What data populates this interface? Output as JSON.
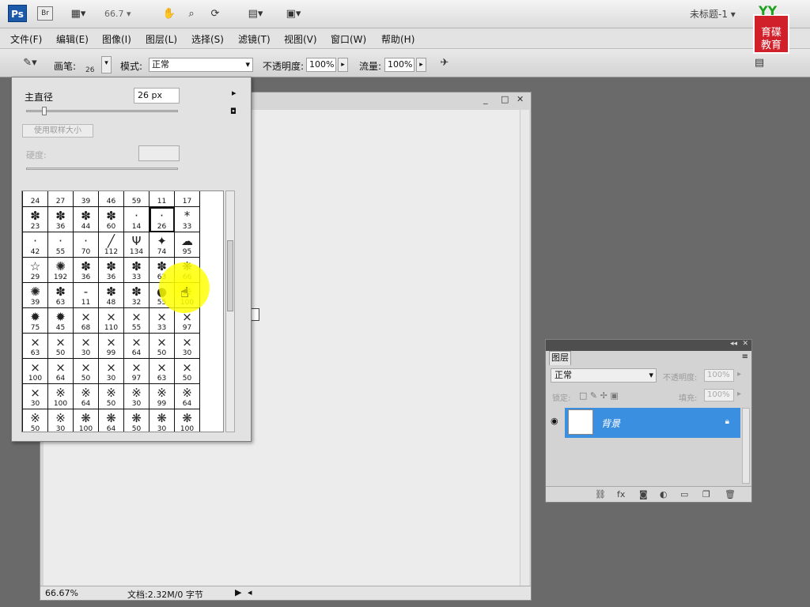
{
  "appbar": {
    "app_badge": "Ps",
    "bridge_badge": "Br",
    "zoom": "66.7",
    "document_title": "未标题-1",
    "watermark_line1": "育碟",
    "watermark_line2": "教育",
    "watermark_top": "YY"
  },
  "menu": [
    "文件(F)",
    "编辑(E)",
    "图像(I)",
    "图层(L)",
    "选择(S)",
    "滤镜(T)",
    "视图(V)",
    "窗口(W)",
    "帮助(H)"
  ],
  "options": {
    "brush_label": "画笔:",
    "brush_size": "26",
    "mode_label": "模式:",
    "mode_value": "正常",
    "opacity_label": "不透明度:",
    "opacity_value": "100%",
    "flow_label": "流量:",
    "flow_value": "100%"
  },
  "brush_picker": {
    "master_diameter_label": "主直径",
    "master_diameter_value": "26 px",
    "use_sample_size": "使用取样大小",
    "hardness_label": "硬度:",
    "brushes": [
      {
        "g": "",
        "s": "24"
      },
      {
        "g": "",
        "s": "27"
      },
      {
        "g": "",
        "s": "39"
      },
      {
        "g": "",
        "s": "46"
      },
      {
        "g": "",
        "s": "59"
      },
      {
        "g": "",
        "s": "11"
      },
      {
        "g": "",
        "s": "17"
      },
      {
        "g": "✽",
        "s": "23"
      },
      {
        "g": "✽",
        "s": "36"
      },
      {
        "g": "✽",
        "s": "44"
      },
      {
        "g": "✽",
        "s": "60"
      },
      {
        "g": "·",
        "s": "14"
      },
      {
        "g": "·",
        "s": "26"
      },
      {
        "g": "*",
        "s": "33"
      },
      {
        "g": "·",
        "s": "42"
      },
      {
        "g": "·",
        "s": "55"
      },
      {
        "g": "·",
        "s": "70"
      },
      {
        "g": "╱",
        "s": "112"
      },
      {
        "g": "Ψ",
        "s": "134"
      },
      {
        "g": "✦",
        "s": "74"
      },
      {
        "g": "☁",
        "s": "95"
      },
      {
        "g": "☆",
        "s": "29"
      },
      {
        "g": "✺",
        "s": "192"
      },
      {
        "g": "✽",
        "s": "36"
      },
      {
        "g": "✽",
        "s": "36"
      },
      {
        "g": "✽",
        "s": "33"
      },
      {
        "g": "✽",
        "s": "63"
      },
      {
        "g": "❋",
        "s": "66"
      },
      {
        "g": "✺",
        "s": "39"
      },
      {
        "g": "✽",
        "s": "63"
      },
      {
        "g": "-",
        "s": "11"
      },
      {
        "g": "✽",
        "s": "48"
      },
      {
        "g": "✽",
        "s": "32"
      },
      {
        "g": "●",
        "s": "55"
      },
      {
        "g": "❋",
        "s": "100"
      },
      {
        "g": "✹",
        "s": "75"
      },
      {
        "g": "✹",
        "s": "45"
      },
      {
        "g": "×",
        "s": "68"
      },
      {
        "g": "×",
        "s": "110"
      },
      {
        "g": "×",
        "s": "55"
      },
      {
        "g": "×",
        "s": "33"
      },
      {
        "g": "×",
        "s": "97"
      },
      {
        "g": "×",
        "s": "63"
      },
      {
        "g": "×",
        "s": "50"
      },
      {
        "g": "×",
        "s": "30"
      },
      {
        "g": "×",
        "s": "99"
      },
      {
        "g": "×",
        "s": "64"
      },
      {
        "g": "×",
        "s": "50"
      },
      {
        "g": "×",
        "s": "30"
      },
      {
        "g": "×",
        "s": "100"
      },
      {
        "g": "×",
        "s": "64"
      },
      {
        "g": "×",
        "s": "50"
      },
      {
        "g": "×",
        "s": "30"
      },
      {
        "g": "×",
        "s": "97"
      },
      {
        "g": "×",
        "s": "63"
      },
      {
        "g": "×",
        "s": "50"
      },
      {
        "g": "×",
        "s": "30"
      },
      {
        "g": "※",
        "s": "100"
      },
      {
        "g": "※",
        "s": "64"
      },
      {
        "g": "※",
        "s": "50"
      },
      {
        "g": "※",
        "s": "30"
      },
      {
        "g": "※",
        "s": "99"
      },
      {
        "g": "※",
        "s": "64"
      },
      {
        "g": "※",
        "s": "50"
      },
      {
        "g": "※",
        "s": "30"
      },
      {
        "g": "❋",
        "s": "100"
      },
      {
        "g": "❋",
        "s": "64"
      },
      {
        "g": "❋",
        "s": "50"
      },
      {
        "g": "❋",
        "s": "30"
      },
      {
        "g": "❋",
        "s": "100"
      },
      {
        "g": "▬",
        "s": ""
      },
      {
        "g": "▬",
        "s": ""
      },
      {
        "g": "▬",
        "s": ""
      },
      {
        "g": "◓",
        "s": ""
      },
      {
        "g": "◓",
        "s": ""
      },
      {
        "g": "◓",
        "s": ""
      },
      {
        "g": "◓",
        "s": ""
      }
    ],
    "selected_index": 12
  },
  "status": {
    "zoom": "66.67%",
    "doc_info": "文档:2.32M/0 字节"
  },
  "layers_panel": {
    "tab": "图层",
    "blend_mode": "正常",
    "opacity_label": "不透明度:",
    "opacity_value": "100%",
    "lock_label": "锁定:",
    "fill_label": "填充:",
    "fill_value": "100%",
    "layer_name": "背景"
  },
  "colors": {
    "layer_selected": "#3b8fe0",
    "highlight": "#ffff00",
    "watermark_red": "#d0202a"
  }
}
